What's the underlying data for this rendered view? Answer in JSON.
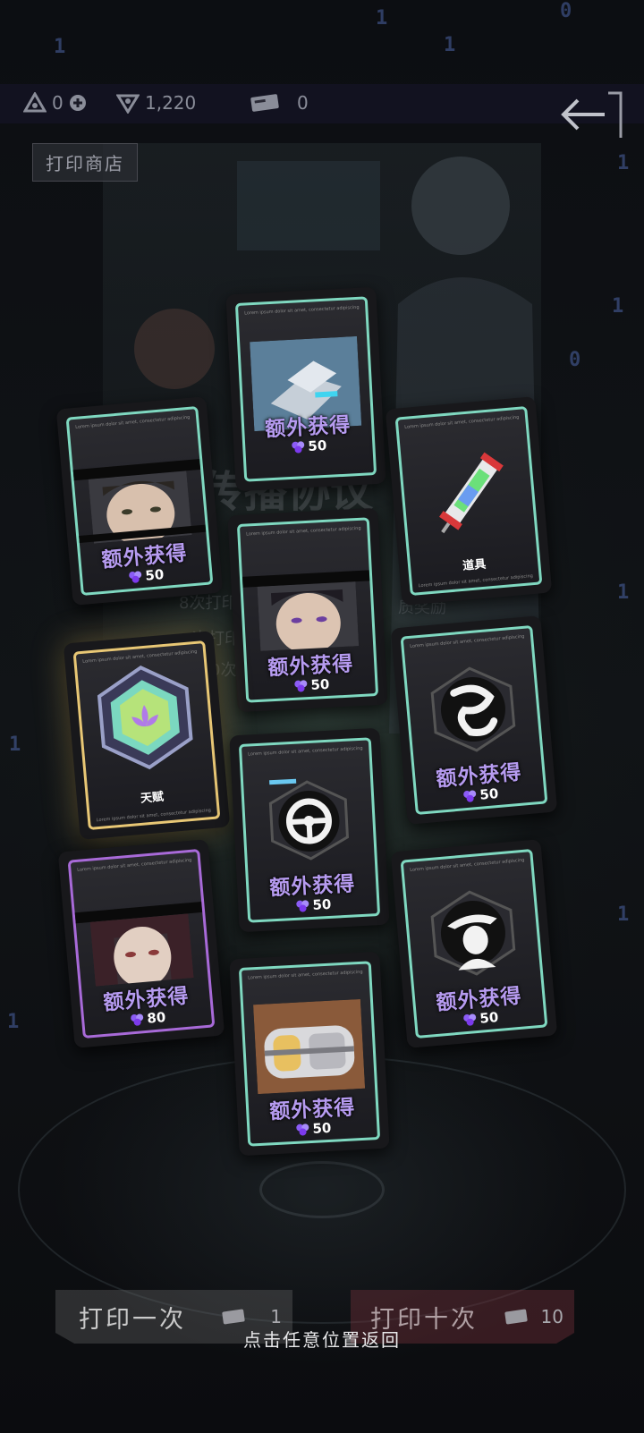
{
  "resources": {
    "res1_value": "0",
    "res2_value": "1,220",
    "tickets_value": "0"
  },
  "shop_title": "打印商店",
  "poster": {
    "title_fragment": "传播协议",
    "line1": "8次打印",
    "line1b": "质奖励",
    "line2": "次打印",
    "line3": "0次"
  },
  "cards": [
    {
      "id": "c1",
      "label": "额外获得",
      "cost": "50",
      "frame": "teal",
      "art": "machine-icon"
    },
    {
      "id": "c2",
      "label": "额外获得",
      "cost": "50",
      "frame": "teal",
      "art": "portrait-man"
    },
    {
      "id": "c3",
      "label": "道具",
      "cost": "",
      "frame": "teal",
      "art": "syringe-icon"
    },
    {
      "id": "c4",
      "label": "额外获得",
      "cost": "50",
      "frame": "teal",
      "art": "portrait-boy"
    },
    {
      "id": "c5",
      "label": "天赋",
      "cost": "",
      "frame": "gold",
      "art": "lotus-emblem-icon"
    },
    {
      "id": "c6",
      "label": "额外获得",
      "cost": "50",
      "frame": "teal",
      "art": "dragon-emblem-icon"
    },
    {
      "id": "c7",
      "label": "额外获得",
      "cost": "50",
      "frame": "teal",
      "art": "wheel-emblem-icon"
    },
    {
      "id": "c8",
      "label": "额外获得",
      "cost": "80",
      "frame": "purple",
      "art": "portrait-woman"
    },
    {
      "id": "c9",
      "label": "额外获得",
      "cost": "50",
      "frame": "teal",
      "art": "hat-emblem-icon"
    },
    {
      "id": "c10",
      "label": "额外获得",
      "cost": "50",
      "frame": "teal",
      "art": "capsule-icon"
    }
  ],
  "lorem": "Lorem ipsum dolor sit amet, consectetur adipiscing",
  "buttons": {
    "once_label": "打印一次",
    "once_count": "1",
    "ten_label": "打印十次",
    "ten_count": "10"
  },
  "hint": "点击任意位置返回",
  "colors": {
    "teal_frame": "#7fd8c0",
    "gold_frame": "#e8c775",
    "purple_frame": "#a86ad8",
    "label_purple": "#b69bf0"
  }
}
